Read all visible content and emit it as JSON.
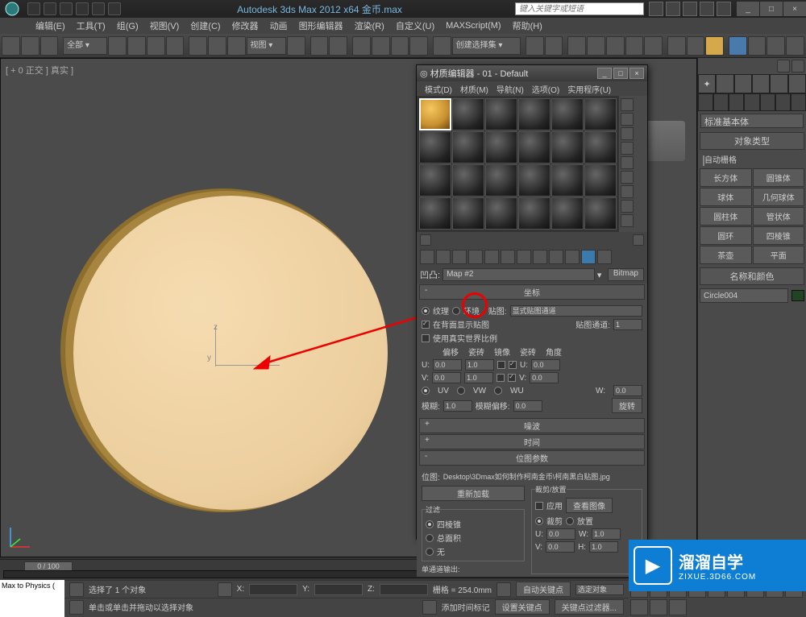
{
  "titlebar": {
    "app_title": "Autodesk 3ds Max  2012 x64    金币.max",
    "search_placeholder": "键入关键字或短语",
    "min": "_",
    "max": "□",
    "close": "×"
  },
  "menubar": {
    "items": [
      "编辑(E)",
      "工具(T)",
      "组(G)",
      "视图(V)",
      "创建(C)",
      "修改器",
      "动画",
      "图形编辑器",
      "渲染(R)",
      "自定义(U)",
      "MAXScript(M)",
      "帮助(H)"
    ]
  },
  "maintoolbar": {
    "select_filter": "全部 ▾",
    "ref_label": "视图  ▾",
    "sel_set": "创建选择集      ▾"
  },
  "viewport": {
    "label": "[ + 0 正交 ] 真实 ]",
    "axis_y": "y",
    "axis_z": "z"
  },
  "cmdpanel": {
    "category": "标准基本体",
    "rollout_objtype": "对象类型",
    "autogrid": "自动栅格",
    "buttons": [
      "长方体",
      "圆锥体",
      "球体",
      "几何球体",
      "圆柱体",
      "管状体",
      "圆环",
      "四棱锥",
      "茶壶",
      "平面"
    ],
    "rollout_name": "名称和颜色",
    "obj_name": "Circle004"
  },
  "materialEditor": {
    "title": "材质编辑器 - 01 - Default",
    "menu": [
      "模式(D)",
      "材质(M)",
      "导航(N)",
      "选项(O)",
      "实用程序(U)"
    ],
    "level_label": "凹凸:",
    "map_name": "Map #2",
    "map_type": "Bitmap",
    "rollout_coord": "坐标",
    "texture": "纹理",
    "env": "环境",
    "map_lbl": "贴图:",
    "map_channel_combo": "显式贴图通道",
    "show_back": "在背面显示贴图",
    "map_channel_lbl": "贴图通道:",
    "map_channel_val": "1",
    "use_real": "使用真实世界比例",
    "col_offset": "偏移",
    "col_tile": "瓷砖",
    "col_mirror": "镜像",
    "col_tile2": "瓷砖",
    "col_angle": "角度",
    "u_lbl": "U:",
    "v_lbl": "V:",
    "w_lbl": "W:",
    "u_off": "0.0",
    "u_tile": "1.0",
    "u_ang": "0.0",
    "v_off": "0.0",
    "v_tile": "1.0",
    "v_ang": "0.0",
    "w_ang": "0.0",
    "uv": "UV",
    "vw": "VW",
    "wu": "WU",
    "blur_lbl": "模糊:",
    "blur_val": "1.0",
    "bluroff_lbl": "模糊偏移:",
    "bluroff_val": "0.0",
    "rotate_btn": "旋转",
    "rollout_noise": "噪波",
    "rollout_time": "时间",
    "rollout_bitmap": "位图参数",
    "bitmap_lbl": "位图:",
    "bitmap_path": "Desktop\\3Dmax如何制作柯南金币\\柯南黑白贴图.jpg",
    "reload_btn": "重新加载",
    "crop_title": "裁剪/放置",
    "apply": "应用",
    "view_img": "查看图像",
    "crop": "裁剪",
    "place": "放置",
    "crop_u": "0.0",
    "crop_w": "1.0",
    "crop_v": "0.0",
    "crop_h": "1.0",
    "filter_title": "过滤",
    "pyramid": "四棱锥",
    "summed": "总面积",
    "none": "无",
    "mono_lbl": "单通道输出:"
  },
  "timeline": {
    "frame": "0 / 100"
  },
  "status": {
    "maxscript": "Max to Physics (",
    "sel_text": "选择了 1 个对象",
    "hint": "单击或单击并拖动以选择对象",
    "x": "X:",
    "y": "Y:",
    "z": "Z:",
    "grid_lbl": "栅格 = 254.0mm",
    "add_time": "添加时间标记",
    "autokey": "自动关键点",
    "setkey": "设置关键点",
    "selset": "选定对象",
    "keyfilter": "关键点过滤器..."
  },
  "watermark": {
    "big": "溜溜自学",
    "small": "ZIXUE.3D66.COM",
    "icon": "▶"
  }
}
